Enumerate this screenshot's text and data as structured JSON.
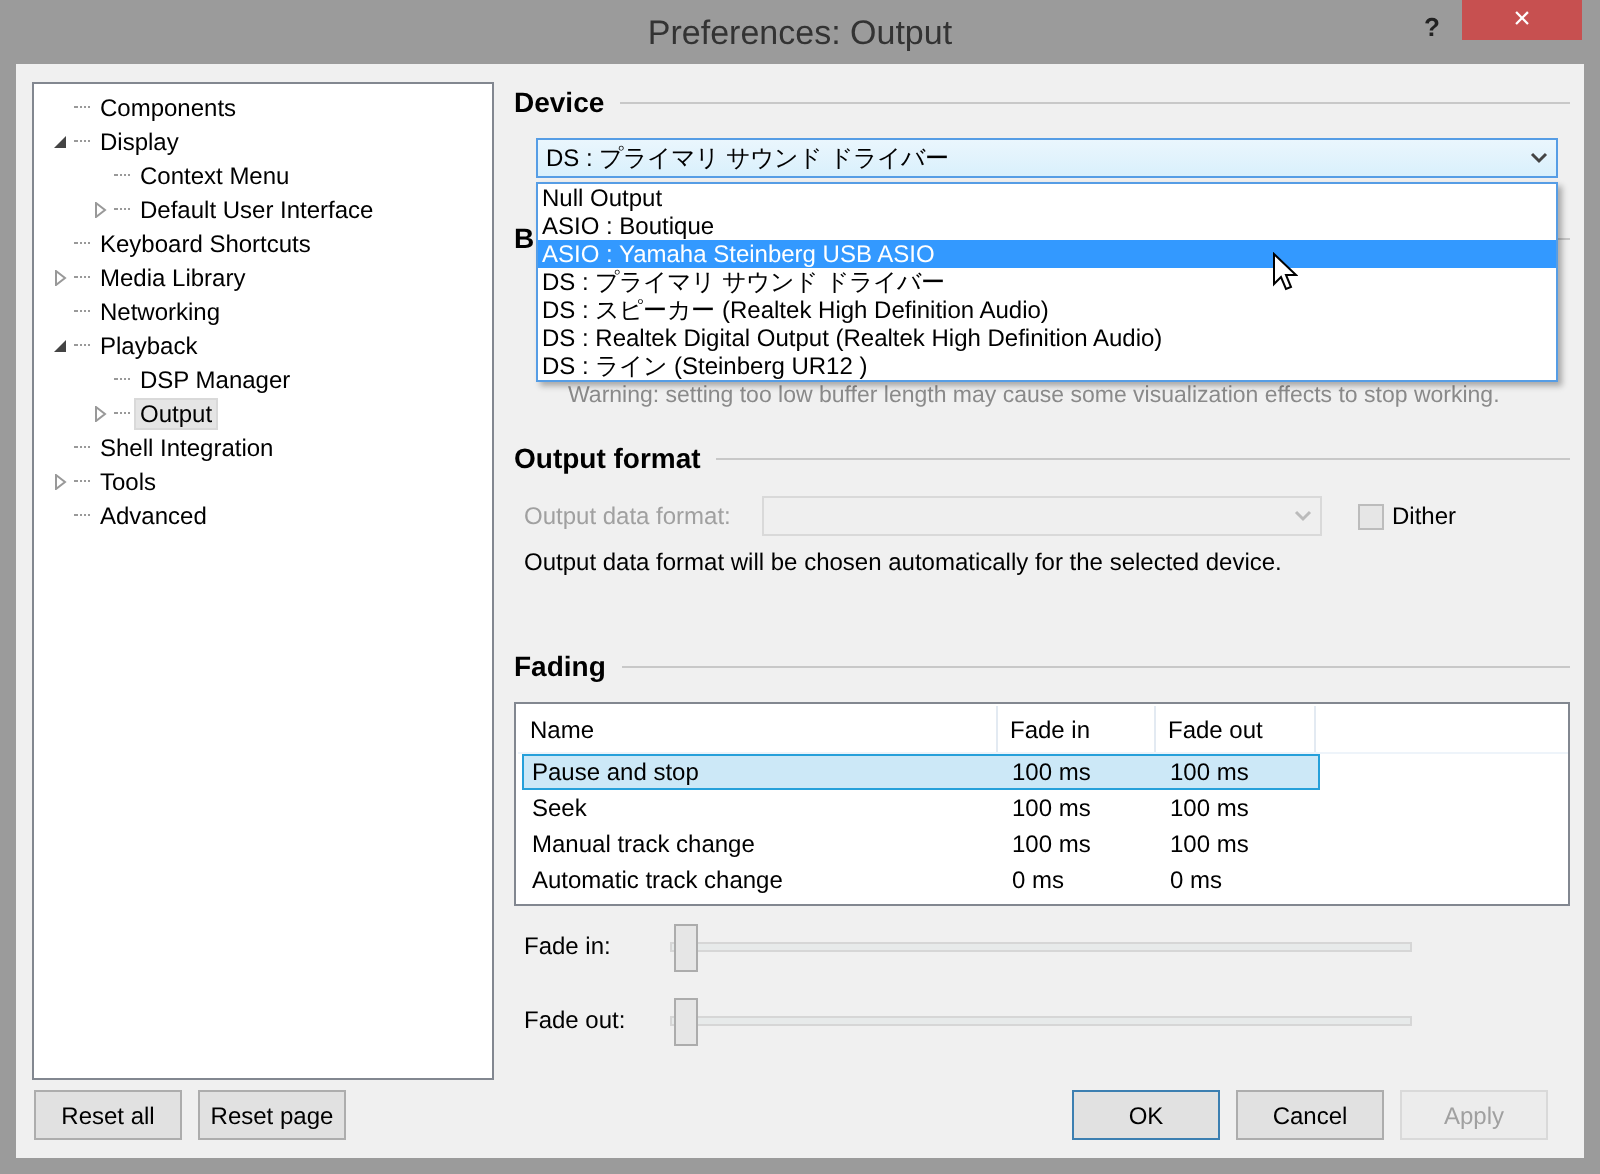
{
  "window": {
    "title": "Preferences: Output",
    "help": "?",
    "close": "×"
  },
  "tree": [
    {
      "label": "Components",
      "selected": false
    },
    {
      "label": "Display",
      "selected": false,
      "expanded": true,
      "children": [
        {
          "label": "Context Menu",
          "selected": false
        },
        {
          "label": "Default User Interface",
          "selected": false,
          "expanded": false
        }
      ]
    },
    {
      "label": "Keyboard Shortcuts",
      "selected": false
    },
    {
      "label": "Media Library",
      "selected": false,
      "expanded": false
    },
    {
      "label": "Networking",
      "selected": false
    },
    {
      "label": "Playback",
      "selected": false,
      "expanded": true,
      "children": [
        {
          "label": "DSP Manager",
          "selected": false
        },
        {
          "label": "Output",
          "selected": true,
          "expanded": false
        }
      ]
    },
    {
      "label": "Shell Integration",
      "selected": false
    },
    {
      "label": "Tools",
      "selected": false,
      "expanded": false
    },
    {
      "label": "Advanced",
      "selected": false
    }
  ],
  "device": {
    "heading": "Device",
    "value": "DS : プライマリ サウンド ドライバー",
    "open": true,
    "options": [
      {
        "label": "Null Output",
        "highlighted": false
      },
      {
        "label": "ASIO : Boutique",
        "highlighted": false
      },
      {
        "label": "ASIO : Yamaha Steinberg USB ASIO",
        "highlighted": true
      },
      {
        "label": "DS : プライマリ サウンド ドライバー",
        "highlighted": false
      },
      {
        "label": "DS : スピーカー (Realtek High Definition Audio)",
        "highlighted": false
      },
      {
        "label": "DS : Realtek Digital Output (Realtek High Definition Audio)",
        "highlighted": false
      },
      {
        "label": "DS : ライン (Steinberg UR12 )",
        "highlighted": false
      }
    ]
  },
  "buffer": {
    "heading": "B",
    "warning": "Warning: setting too low buffer length may cause some visualization effects to stop working."
  },
  "output_format": {
    "heading": "Output format",
    "label": "Output data format:",
    "disabled": true,
    "dither": {
      "label": "Dither",
      "checked": false,
      "disabled": true
    },
    "info": "Output data format will be chosen automatically for the selected device."
  },
  "fading": {
    "heading": "Fading",
    "columns": [
      "Name",
      "Fade in",
      "Fade out"
    ],
    "rows": [
      {
        "cells": [
          "Pause and stop",
          "100 ms",
          "100 ms"
        ],
        "selected": true
      },
      {
        "cells": [
          "Seek",
          "100 ms",
          "100 ms"
        ],
        "selected": false
      },
      {
        "cells": [
          "Manual track change",
          "100 ms",
          "100 ms"
        ],
        "selected": false
      },
      {
        "cells": [
          "Automatic track change",
          "0 ms",
          "0 ms"
        ],
        "selected": false
      }
    ],
    "sliders": [
      {
        "label": "Fade in:",
        "level": 0
      },
      {
        "label": "Fade out:",
        "level": 0
      }
    ]
  },
  "buttons": [
    {
      "label": "Reset all",
      "kind": "left",
      "disabled": false,
      "default": false
    },
    {
      "label": "Reset page",
      "kind": "left",
      "disabled": false,
      "default": false
    },
    {
      "label": "OK",
      "kind": "right",
      "disabled": false,
      "default": true
    },
    {
      "label": "Cancel",
      "kind": "right",
      "disabled": false,
      "default": false
    },
    {
      "label": "Apply",
      "kind": "right",
      "disabled": true,
      "default": false
    }
  ]
}
